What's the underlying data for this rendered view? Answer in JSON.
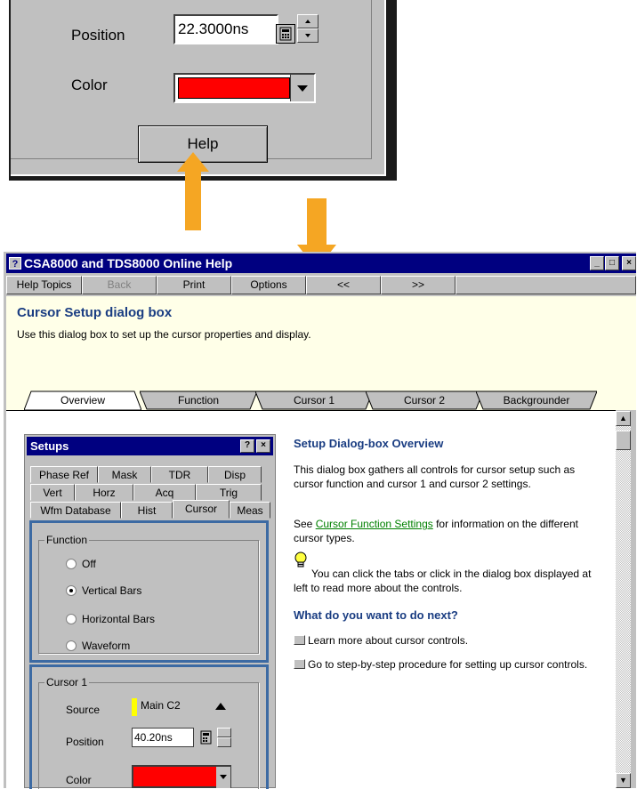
{
  "top_dialog": {
    "position_label": "Position",
    "position_value": "22.3000ns",
    "color_label": "Color",
    "help_button": "Help"
  },
  "window": {
    "title": "CSA8000 and TDS8000 Online Help",
    "toolbar": [
      "Help Topics",
      "Back",
      "Print",
      "Options",
      "<<",
      ">>"
    ],
    "topic_title": "Cursor Setup dialog box",
    "topic_desc": "Use this dialog box to set up the cursor properties and display.",
    "tabs": [
      "Overview",
      "Function",
      "Cursor 1",
      "Cursor 2",
      "Backgrounder"
    ]
  },
  "setups": {
    "title": "Setups",
    "help_btn": "?",
    "close_btn": "×",
    "tab_row1": [
      "Phase Ref",
      "Mask",
      "TDR",
      "Disp"
    ],
    "tab_row2": [
      "Vert",
      "Horz",
      "Acq",
      "Trig"
    ],
    "tab_row3": [
      "Wfm Database",
      "Hist",
      "Cursor",
      "Meas"
    ],
    "function_legend": "Function",
    "radios": [
      "Off",
      "Vertical Bars",
      "Horizontal Bars",
      "Waveform"
    ],
    "cursor1_legend": "Cursor 1",
    "source_label": "Source",
    "source_value": "Main C2",
    "position_label": "Position",
    "position_value": "40.20ns",
    "color_label": "Color"
  },
  "content": {
    "heading1": "Setup Dialog-box Overview",
    "para1": "This dialog box gathers all controls for cursor setup such as cursor function and cursor 1 and cursor 2 settings.",
    "para2_pre": "See ",
    "para2_link": "Cursor Function Settings",
    "para2_post": " for information on the different cursor types.",
    "tip": "You can click the tabs or click in the dialog box displayed at left to read more about the controls.",
    "heading2": "What do you want to do next?",
    "item1": "Learn more about cursor controls.",
    "item2": "Go to step-by-step procedure for setting up cursor controls."
  },
  "colors": {
    "arrow": "#f5a623",
    "title_bar": "#000080",
    "heading": "#1a3d82",
    "selected_color": "#ff0000",
    "highlight_frame": "#3c6aa3"
  }
}
